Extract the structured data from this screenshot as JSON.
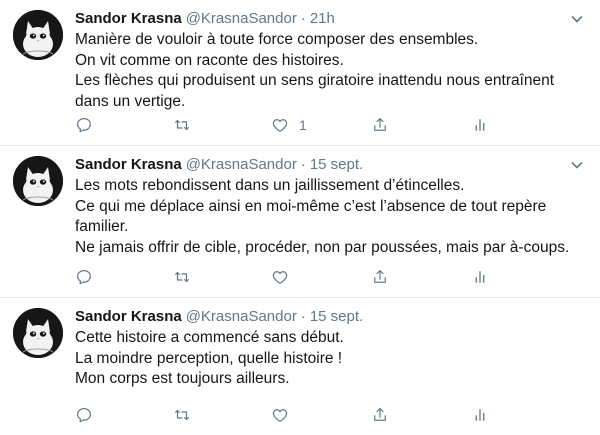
{
  "tweets": [
    {
      "author": "Sandor Krasna",
      "handle": "@KrasnaSandor",
      "separator": "·",
      "time": "21h",
      "lines": [
        "Manière de vouloir à toute force composer des ensembles.",
        "On vit comme on raconte des histoires.",
        "Les flèches qui produisent un sens giratoire inattendu nous entraînent dans un vertige."
      ],
      "likes": "1"
    },
    {
      "author": "Sandor Krasna",
      "handle": "@KrasnaSandor",
      "separator": "·",
      "time": "15 sept.",
      "lines": [
        "Les mots rebondissent dans un jaillissement d’étincelles.",
        "Ce qui me déplace ainsi en moi-même c’est l’absence de tout repère familier.",
        "Ne jamais offrir de cible, procéder, non par poussées, mais par à-coups."
      ],
      "likes": ""
    },
    {
      "author": "Sandor Krasna",
      "handle": "@KrasnaSandor",
      "separator": "·",
      "time": "15 sept.",
      "lines": [
        "Cette histoire a commencé sans début.",
        "La moindre perception, quelle histoire !",
        "Mon corps est toujours ailleurs."
      ],
      "likes": ""
    }
  ],
  "icons": {
    "reply": "reply-icon",
    "retweet": "retweet-icon",
    "like": "like-icon",
    "share": "share-icon",
    "analytics": "analytics-icon",
    "caret": "chevron-down-icon"
  },
  "colors": {
    "text": "#14171a",
    "secondary": "#657786",
    "divider": "#e6ecf0",
    "avatar_bg": "#161616"
  }
}
